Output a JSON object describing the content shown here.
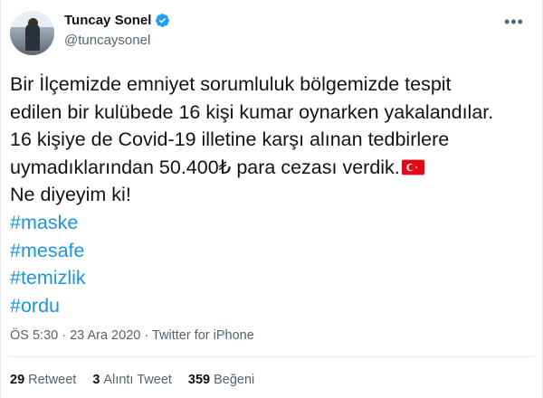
{
  "tweet": {
    "author": {
      "name": "Tuncay Sonel",
      "handle": "@tuncaysonel",
      "verified": true
    },
    "text_lines": [
      "Bir İlçemizde emniyet sorumluluk bölgemizde tespit",
      "edilen bir kulübede 16 kişi kumar oynarken yakalandılar.",
      "16 kişiye de Covid-19 illetine karşı alınan tedbirlere",
      "uymadıklarından 50.400₺ para cezası verdik.",
      "Ne diyeyim ki!"
    ],
    "hashtags": [
      "#maske",
      "#mesafe",
      "#temizlik",
      "#ordu"
    ],
    "time": "ÖS 5:30",
    "separator": "·",
    "date": "23 Ara 2020",
    "source": "Twitter for iPhone",
    "stats": {
      "retweets": {
        "count": "29",
        "label": "Retweet"
      },
      "quotes": {
        "count": "3",
        "label": "Alıntı Tweet"
      },
      "likes": {
        "count": "359",
        "label": "Beğeni"
      }
    }
  },
  "colors": {
    "accent": "#1b95e0",
    "verified": "#1da1f2",
    "flag_red": "#e30a17",
    "muted": "#536471"
  },
  "icons": {
    "verified": "verified-badge-icon",
    "more": "more-options-icon",
    "flag": "turkey-flag-icon"
  }
}
